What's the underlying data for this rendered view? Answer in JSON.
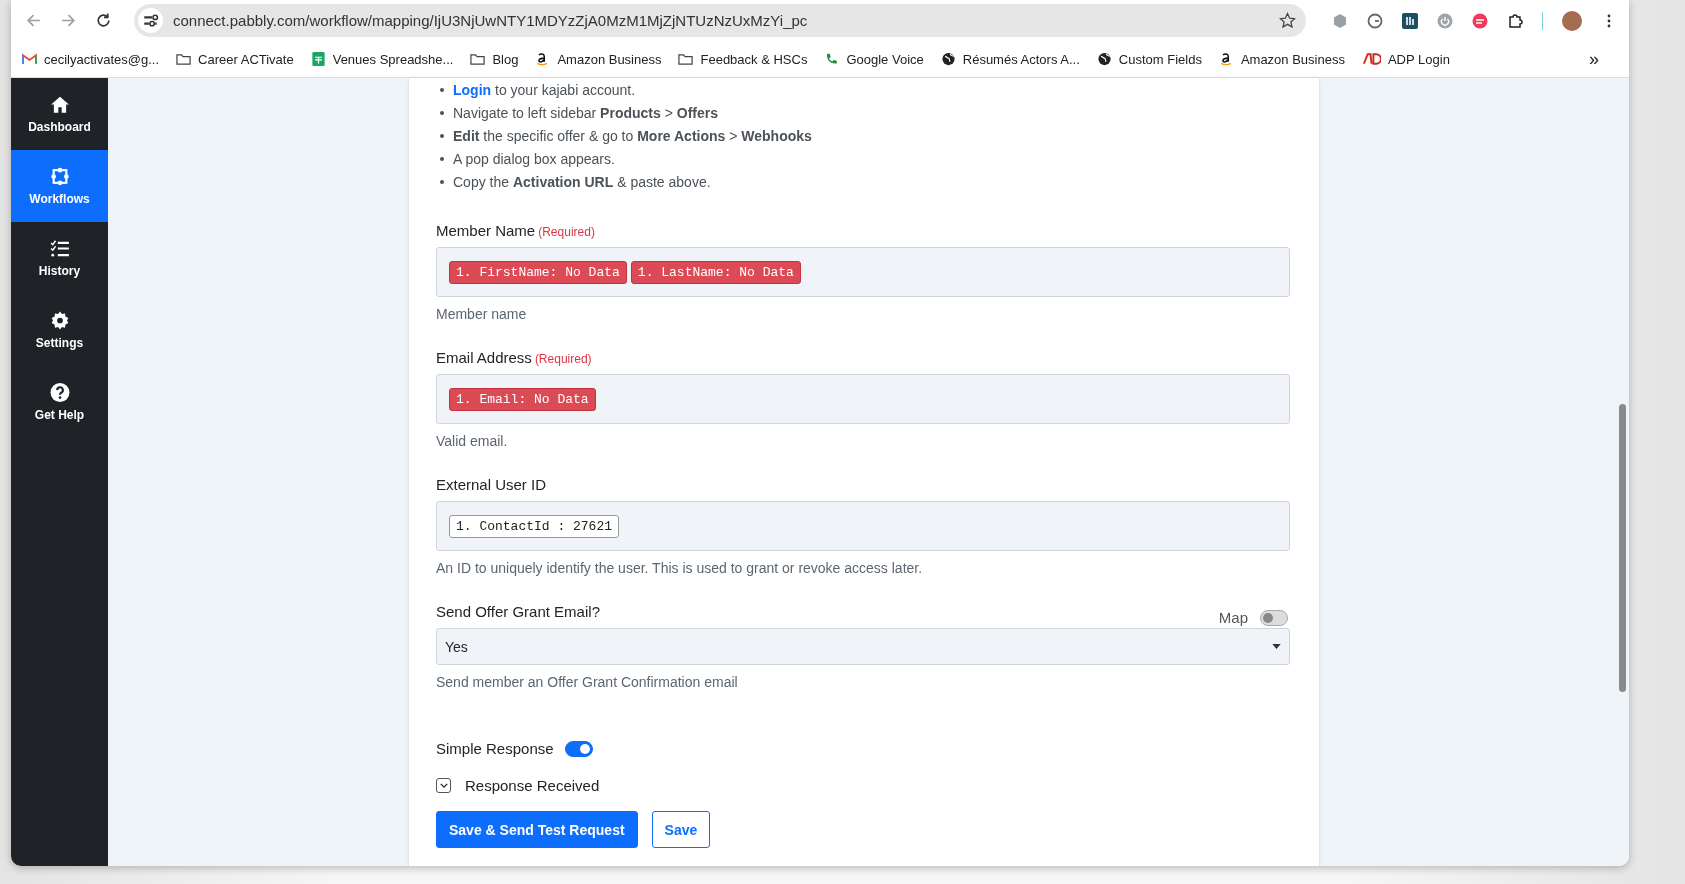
{
  "browser": {
    "url": "connect.pabbly.com/workflow/mapping/IjU3NjUwNTY1MDYzZjA0MzM1MjZjNTUzNzUxMzYi_pc",
    "bookmarks": [
      {
        "kind": "mail",
        "label": "cecilyactivates@g..."
      },
      {
        "kind": "folder",
        "label": "Career ACTivate"
      },
      {
        "kind": "sheet",
        "label": "Venues Spreadshe..."
      },
      {
        "kind": "folder",
        "label": "Blog"
      },
      {
        "kind": "amazon",
        "label": "Amazon Business"
      },
      {
        "kind": "folder",
        "label": "Feedback & HSCs"
      },
      {
        "kind": "phone",
        "label": "Google Voice"
      },
      {
        "kind": "globe",
        "label": "Résumés Actors A..."
      },
      {
        "kind": "globe",
        "label": "Custom Fields"
      },
      {
        "kind": "amazon",
        "label": "Amazon Business"
      },
      {
        "kind": "adp",
        "label": "ADP Login"
      }
    ],
    "more_bookmarks": "»"
  },
  "sidebar": {
    "items": [
      {
        "kind": "home",
        "label": "Dashboard",
        "selected": false
      },
      {
        "kind": "workflow",
        "label": "Workflows",
        "selected": true
      },
      {
        "kind": "history",
        "label": "History",
        "selected": false
      },
      {
        "kind": "settings",
        "label": "Settings",
        "selected": false
      },
      {
        "kind": "help",
        "label": "Get Help",
        "selected": false
      }
    ]
  },
  "instructions": [
    {
      "link": "Login",
      "text": " to your kajabi account."
    },
    {
      "text": "Navigate to left sidebar **Products** > **Offers**"
    },
    {
      "text": "**Edit** the specific offer & go to **More Actions** > **Webhooks**"
    },
    {
      "text": "A pop dialog box appears."
    },
    {
      "text": "Copy the **Activation URL** & paste above."
    }
  ],
  "fields": [
    {
      "kind": "tags",
      "label": "Member Name",
      "required": "(Required)",
      "tags": [
        {
          "text": "1. FirstName: No Data",
          "error": true
        },
        {
          "text": "1. LastName: No Data",
          "error": true
        }
      ],
      "hint": "Member name"
    },
    {
      "kind": "tags",
      "label": "Email Address",
      "required": "(Required)",
      "tags": [
        {
          "text": "1. Email: No Data",
          "error": true
        }
      ],
      "hint": "Valid email."
    },
    {
      "kind": "tags",
      "label": "External User ID",
      "tags": [
        {
          "text": "1. ContactId : 27621",
          "error": false
        }
      ],
      "hint": "An ID to uniquely identify the user. This is used to grant or revoke access later."
    },
    {
      "kind": "select",
      "label": "Send Offer Grant Email?",
      "map_label": "Map",
      "map_on": false,
      "value": "Yes",
      "hint": "Send member an Offer Grant Confirmation email"
    }
  ],
  "simple_response": {
    "label": "Simple Response",
    "on": true
  },
  "response_received": {
    "label": "Response Received",
    "expanded": false
  },
  "buttons": [
    {
      "kind": "primary",
      "label": "Save & Send Test Request"
    },
    {
      "kind": "outline",
      "label": "Save"
    }
  ]
}
